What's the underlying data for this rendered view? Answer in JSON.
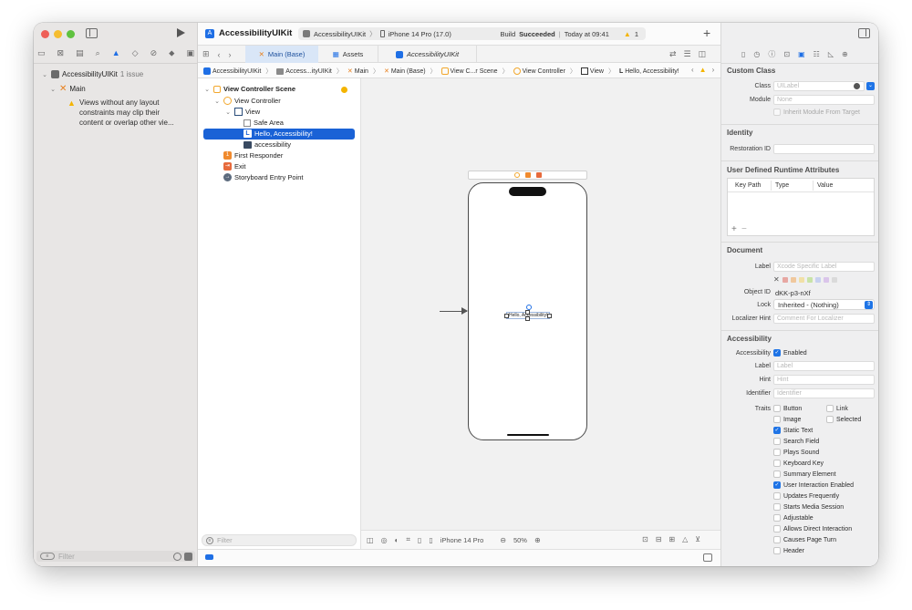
{
  "project": {
    "name": "AccessibilityUIKit",
    "issue_count": "1 issue",
    "group": "Main",
    "warning_text": [
      "Views without any layout",
      "constraints may clip their",
      "content or overlap other vie..."
    ],
    "filter_placeholder": "Filter"
  },
  "toolbar": {
    "app_title": "AccessibilityUIKit",
    "scheme": "AccessibilityUIKit",
    "device": "iPhone 14 Pro (17.0)",
    "build_prefix": "Build",
    "build_status": "Succeeded",
    "build_time": "Today at 09:41",
    "warning_count": "1"
  },
  "tabs": [
    "Main (Base)",
    "Assets",
    "AccessibilityUIKit"
  ],
  "jumpbar": [
    "AccessibilityUIKit",
    "Access...ityUIKit",
    "Main",
    "Main (Base)",
    "View C...r Scene",
    "View Controller",
    "View",
    "Hello, Accessibility!"
  ],
  "outline": {
    "scene": "View Controller Scene",
    "view_controller": "View Controller",
    "view": "View",
    "safe_area": "Safe Area",
    "label": "Hello, Accessibility!",
    "accessibility": "accessibility",
    "first_responder": "First Responder",
    "exit": "Exit",
    "entry_point": "Storyboard Entry Point",
    "filter_placeholder": "Filter"
  },
  "canvas": {
    "label_text": "Hello, Accessibility!",
    "device": "iPhone 14 Pro",
    "zoom": "50%"
  },
  "inspector": {
    "custom_class": {
      "title": "Custom Class",
      "class_label": "Class",
      "class_placeholder": "UILabel",
      "module_label": "Module",
      "module_placeholder": "None",
      "inherit": "Inherit Module From Target"
    },
    "identity": {
      "title": "Identity",
      "restoration_label": "Restoration ID"
    },
    "runtime": {
      "title": "User Defined Runtime Attributes",
      "columns": [
        "Key Path",
        "Type",
        "Value"
      ]
    },
    "document": {
      "title": "Document",
      "label_label": "Label",
      "label_placeholder": "Xcode Specific Label",
      "object_id_label": "Object ID",
      "object_id": "dKK-p3-nXf",
      "lock_label": "Lock",
      "lock_value": "Inherited - (Nothing)",
      "localizer_label": "Localizer Hint",
      "localizer_placeholder": "Comment For Localizer",
      "colors": [
        "#e06b62",
        "#f0a85a",
        "#f2d36a",
        "#a7d86b",
        "#a8b8f0",
        "#c9a3e6",
        "#c8c8c8"
      ]
    },
    "accessibility": {
      "title": "Accessibility",
      "accessibility_label": "Accessibility",
      "enabled": "Enabled",
      "label_label": "Label",
      "label_placeholder": "Label",
      "hint_label": "Hint",
      "hint_placeholder": "Hint",
      "identifier_label": "Identifier",
      "identifier_placeholder": "Identifier",
      "traits_label": "Traits",
      "traits_left": [
        {
          "label": "Button",
          "checked": false
        },
        {
          "label": "Image",
          "checked": false
        },
        {
          "label": "Static Text",
          "checked": true
        },
        {
          "label": "Search Field",
          "checked": false
        },
        {
          "label": "Plays Sound",
          "checked": false
        },
        {
          "label": "Keyboard Key",
          "checked": false
        },
        {
          "label": "Summary Element",
          "checked": false
        },
        {
          "label": "User Interaction Enabled",
          "checked": true
        },
        {
          "label": "Updates Frequently",
          "checked": false
        },
        {
          "label": "Starts Media Session",
          "checked": false
        },
        {
          "label": "Adjustable",
          "checked": false
        },
        {
          "label": "Allows Direct Interaction",
          "checked": false
        },
        {
          "label": "Causes Page Turn",
          "checked": false
        },
        {
          "label": "Header",
          "checked": false
        }
      ],
      "traits_right": [
        {
          "label": "Link",
          "checked": false
        },
        {
          "label": "Selected",
          "checked": false
        }
      ]
    }
  },
  "colors": {
    "accent": "#1f6fe5",
    "warning": "#f4b400",
    "selection": "#1a62d6"
  }
}
